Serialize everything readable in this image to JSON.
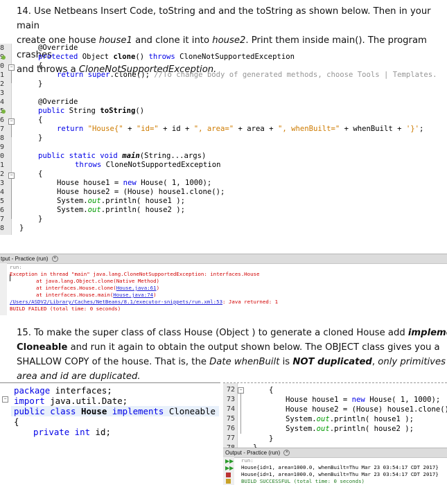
{
  "q14": {
    "l1": "14. Use Netbeans Insert Code, toString and and the toString as shown below. Then in your main",
    "l2a": "create one house ",
    "l2b": "house1",
    "l2c": " and clone it into ",
    "l2d": "house2",
    "l2e": ". Print them inside main(). The program crashes",
    "l3a": "and throws a ",
    "l3b": "CloneNotSupportedException."
  },
  "editor1": {
    "line_numbers": [
      "8",
      "9",
      "0",
      "1",
      "2",
      "3",
      "4",
      "5",
      "6",
      "7",
      "8",
      "9",
      "0",
      "1",
      "2",
      "3",
      "4",
      "5",
      "6",
      "7",
      "8"
    ],
    "lines": {
      "a1": "@Override",
      "a2_kw": "protected",
      "a2_rest1": " Object ",
      "a2_name": "clone",
      "a2_rest2": "() ",
      "a2_kw2": "throws",
      "a2_rest3": " CloneNotSupportedException",
      "a3": "{",
      "a4_kw": "return super",
      "a4_rest": ".clone(); ",
      "a4_cm": "//To change body of generated methods, choose Tools | Templates.",
      "a5": "}",
      "b1": "@Override",
      "b2_kw": "public",
      "b2_rest": " String ",
      "b2_name": "toString",
      "b2_end": "()",
      "b3": "{",
      "b4_kw": "return",
      "b4_s1": " \"House{\"",
      "b4_p1": " + ",
      "b4_s2": "\"id=\"",
      "b4_p2": " + id + ",
      "b4_s3": "\", area=\"",
      "b4_p3": " + area + ",
      "b4_s4": "\", whenBuilt=\"",
      "b4_p4": " + whenBuilt + ",
      "b4_s5": "'}'",
      "b4_end": ";",
      "b5": "}",
      "c1_kw": "public static void",
      "c1_name": "main",
      "c1_rest": "(String...args)",
      "c2_kw": "throws",
      "c2_rest": " CloneNotSupportedException",
      "c3": "{",
      "c4a": "House house1 = ",
      "c4_kw": "new",
      "c4b": " House( 1, 1000);",
      "c5": "House house2 = (House) house1.clone();",
      "c6a": "System.",
      "c6_out": "out",
      "c6b": ".println( house1 );",
      "c7a": "System.",
      "c7_out": "out",
      "c7b": ".println( house2 );",
      "c8": "}",
      "d1": "}"
    }
  },
  "output1": {
    "title": "tput - Practice (run)",
    "run": "run:",
    "e1": "Exception in thread \"main\" java.lang.CloneNotSupportedException: interfaces.House",
    "e2": "at java.lang.Object.clone(Native Method)",
    "e3a": "at interfaces.House.clone(",
    "e3b": "House.java:61",
    "e3c": ")",
    "e4a": "at interfaces.House.main(",
    "e4b": "House.java:74",
    "e4c": ")",
    "e5a": "/Users/ASDV2/Library/Caches/NetBeans/8.1/executor-snippets/run.xml:53",
    "e5b": ": Java returned: 1",
    "e6": "BUILD FAILED (total time: 0 seconds)"
  },
  "q15": {
    "l1a": "15. To make the super class of class House (Object ) to generate a cloned House add ",
    "l1b": "implements",
    "l2a": "Cloneable",
    "l2b": " and run it again to obtain the output shown below. The OBJECT class gives you a",
    "l3a": "SHALLOW COPY of the house. That is, the ",
    "l3b": "Date whenBuilt",
    "l3c": " is ",
    "l3d": "NOT duplicated",
    "l3e": ", ",
    "l3f": "only primitives",
    "l4": "area and id are duplicated."
  },
  "editor2": {
    "l1_kw": "package",
    "l1_rest": " interfaces;",
    "l2_kw": "import",
    "l2_rest": " java.util.Date;",
    "l3_kw": "public class",
    "l3_name": " House ",
    "l3_kw2": "implements",
    "l3_rest": " Cloneable",
    "l4": "{",
    "l5_kw": "private int",
    "l5_rest": " id;"
  },
  "editor3": {
    "line_numbers": [
      "72",
      "73",
      "74",
      "75",
      "76",
      "77",
      "78"
    ],
    "l1": "{",
    "l2a": "House house1 = ",
    "l2_kw": "new",
    "l2b": " House( 1, 1000);",
    "l3": "House house2 = (House) house1.clone();",
    "l4a": "System.",
    "l4_out": "out",
    "l4b": ".println( house1 );",
    "l5a": "System.",
    "l5_out": "out",
    "l5b": ".println( house2 );",
    "l6": "}",
    "l7": "}"
  },
  "output2": {
    "title": "Output - Practice (run)",
    "run": "run:",
    "o1": "House{id=1, area=1000.0, whenBuilt=Thu Mar 23 03:54:17 CDT 2017}",
    "o2": "House{id=1, area=1000.0, whenBuilt=Thu Mar 23 03:54:17 CDT 2017}",
    "o3": "BUILD SUCCESSFUL (total time: 0 seconds)"
  },
  "colors": {
    "keyword": "#0000e6",
    "string": "#ce7b00",
    "comment": "#969696",
    "field": "#009900",
    "error": "#d10000"
  }
}
